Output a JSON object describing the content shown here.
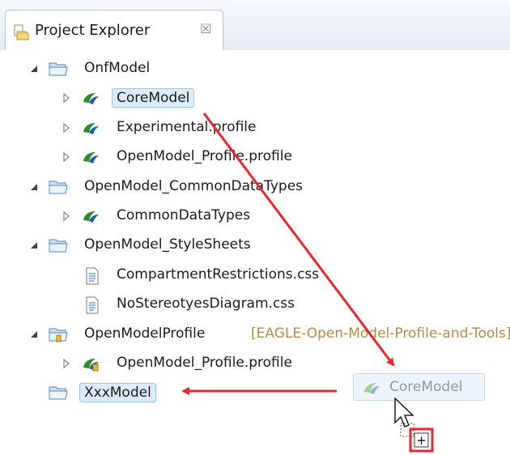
{
  "tab": {
    "label": "Project Explorer",
    "close": "☒"
  },
  "tree": [
    {
      "label": "OnfModel",
      "type": "folder",
      "indent": 0,
      "expanded": true
    },
    {
      "label": "CoreModel",
      "type": "model",
      "indent": 1,
      "expanded": false,
      "selected": true
    },
    {
      "label": "Experimental.profile",
      "type": "model",
      "indent": 1,
      "expanded": false
    },
    {
      "label": "OpenModel_Profile.profile",
      "type": "model",
      "indent": 1,
      "expanded": false
    },
    {
      "label": "OpenModel_CommonDataTypes",
      "type": "folder",
      "indent": 0,
      "expanded": true
    },
    {
      "label": "CommonDataTypes",
      "type": "model",
      "indent": 1,
      "expanded": false
    },
    {
      "label": "OpenModel_StyleSheets",
      "type": "folder",
      "indent": 0,
      "expanded": true
    },
    {
      "label": "CompartmentRestrictions.css",
      "type": "file",
      "indent": 1,
      "expanded": null
    },
    {
      "label": "NoStereotyesDiagram.css",
      "type": "file",
      "indent": 1,
      "expanded": null
    },
    {
      "label": "OpenModelProfile",
      "type": "project",
      "indent": 0,
      "expanded": true,
      "decoration": "[EAGLE-Open-Model-Profile-and-Tools]"
    },
    {
      "label": "OpenModel_Profile.profile",
      "type": "model-profile",
      "indent": 1,
      "expanded": false
    },
    {
      "label": "XxxModel",
      "type": "folder",
      "indent": 0,
      "expanded": null,
      "selected": true
    }
  ],
  "drag": {
    "label": "CoreModel",
    "plus": "+"
  },
  "colors": {
    "arrow": "#e8262b",
    "selection": "#dcebfb",
    "folder": "#6fa0d8"
  }
}
